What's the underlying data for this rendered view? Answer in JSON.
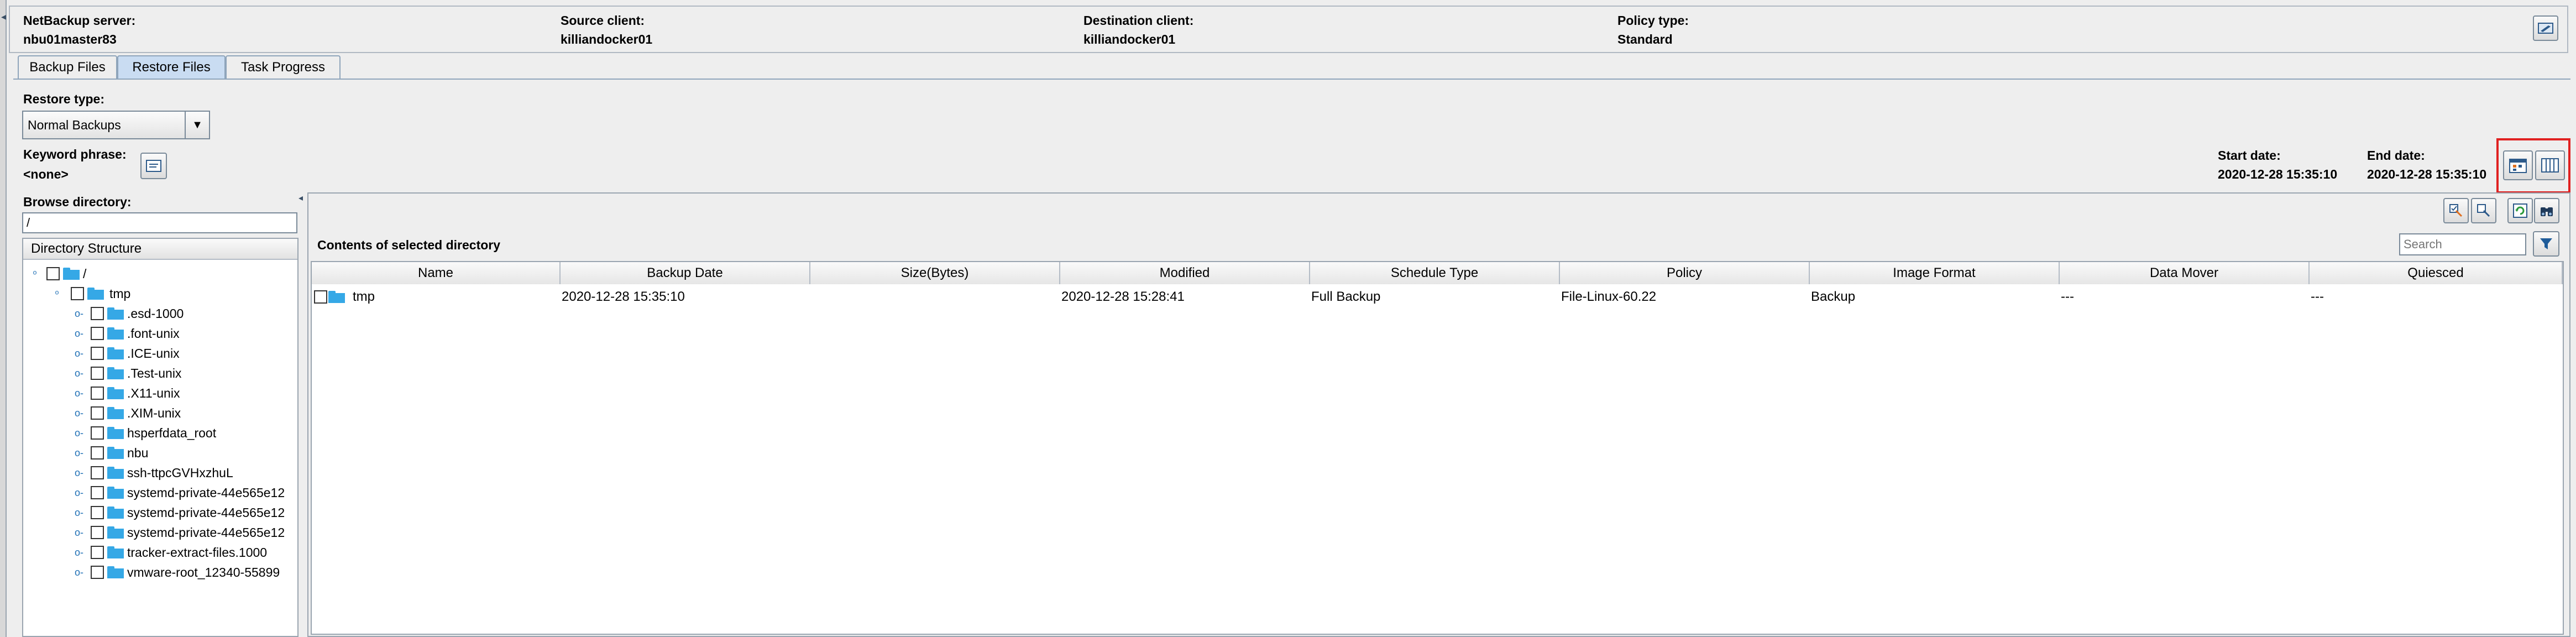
{
  "header": {
    "server_label": "NetBackup server:",
    "server_value": "nbu01master83",
    "source_label": "Source client:",
    "source_value": "killiandocker01",
    "dest_label": "Destination client:",
    "dest_value": "killiandocker01",
    "policy_label": "Policy type:",
    "policy_value": "Standard"
  },
  "tabs": [
    "Backup Files",
    "Restore Files",
    "Task Progress"
  ],
  "restore": {
    "type_label": "Restore type:",
    "type_value": "Normal Backups",
    "keyword_label": "Keyword phrase:",
    "keyword_value": "<none>",
    "start_label": "Start date:",
    "start_value": "2020-12-28 15:35:10",
    "end_label": "End date:",
    "end_value": "2020-12-28 15:35:10"
  },
  "browse": {
    "label": "Browse directory:",
    "value": "/",
    "tree_title": "Directory Structure",
    "root": "/",
    "tmp": "tmp",
    "children": [
      ".esd-1000",
      ".font-unix",
      ".ICE-unix",
      ".Test-unix",
      ".X11-unix",
      ".XIM-unix",
      "hsperfdata_root",
      "nbu",
      "ssh-ttpcGVHxzhuL",
      "systemd-private-44e565e12",
      "systemd-private-44e565e12",
      "systemd-private-44e565e12",
      "tracker-extract-files.1000",
      "vmware-root_12340-55899"
    ]
  },
  "contents": {
    "title": "Contents of selected directory",
    "search_placeholder": "Search",
    "columns": [
      "Name",
      "Backup Date",
      "Size(Bytes)",
      "Modified",
      "Schedule Type",
      "Policy",
      "Image Format",
      "Data Mover",
      "Quiesced"
    ],
    "rows": [
      {
        "name": "tmp",
        "backup_date": "2020-12-28 15:35:10",
        "size": "",
        "modified": "2020-12-28 15:28:41",
        "schedule": "Full Backup",
        "policy": "File-Linux-60.22",
        "format": "Backup",
        "mover": "---",
        "quiesced": "---"
      }
    ]
  },
  "colors": {
    "folder": "#35a8e6",
    "highlight_box": "#e02020",
    "active_tab": "#c9dcf2"
  }
}
